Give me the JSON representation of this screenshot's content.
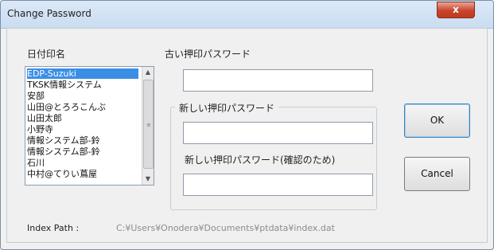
{
  "window": {
    "title": "Change Password",
    "close_glyph": "x"
  },
  "form": {
    "date_label": "日付印名",
    "old_password_label": "古い押印パスワード",
    "new_password_group_label": "新しい押印パスワード",
    "confirm_password_label": "新しい押印パスワード(確認のため)",
    "old_password_value": "",
    "new_password_value": "",
    "confirm_password_value": ""
  },
  "stamp_list": {
    "items": [
      "EDP-Suzuki",
      "TKSK情報システム",
      "安部",
      "山田@とろろこんぶ",
      "山田太郎",
      "小野寺",
      "情報システム部-鈴",
      "情報システム部-鈴",
      "石川",
      "中村@てりい蔦屋"
    ],
    "selected_index": 0
  },
  "buttons": {
    "ok": "OK",
    "cancel": "Cancel"
  },
  "footer": {
    "index_path_label": "Index Path :",
    "index_path_value": "C:¥Users¥Onodera¥Documents¥ptdata¥index.dat"
  }
}
